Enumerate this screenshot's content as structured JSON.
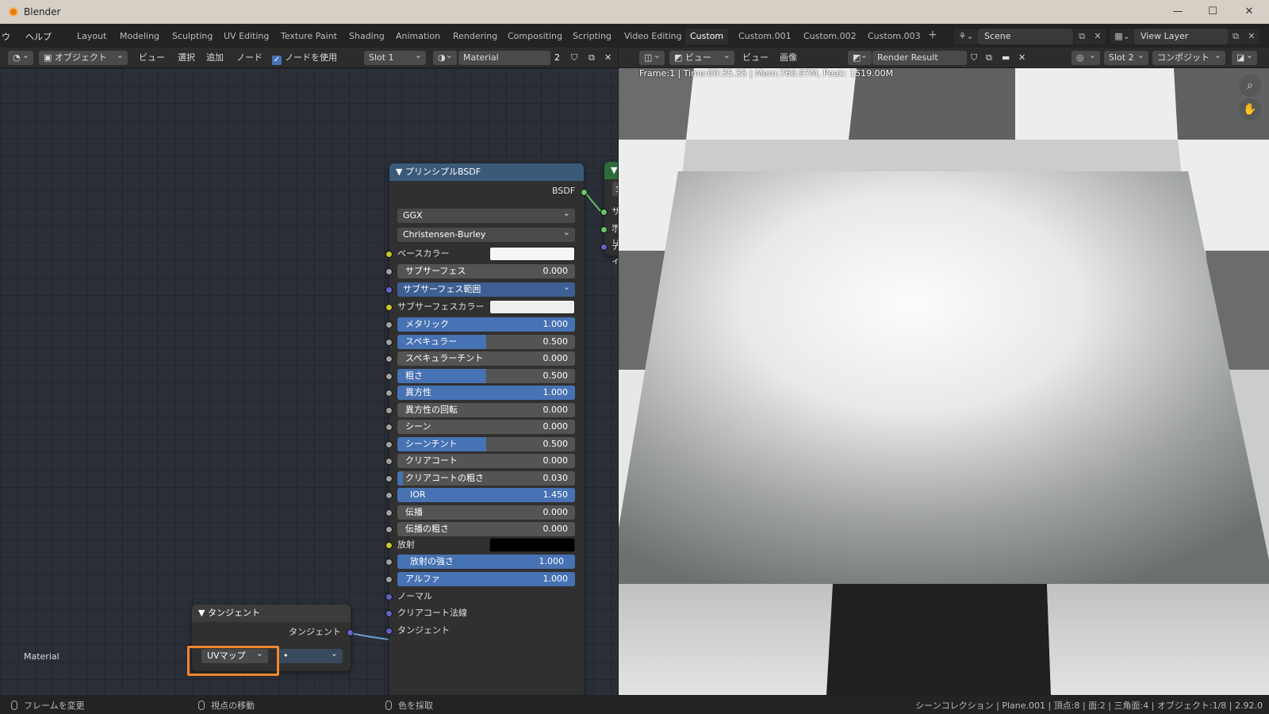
{
  "window": {
    "title": "Blender",
    "minimize": "—",
    "maximize": "☐",
    "close": "✕"
  },
  "menubar": {
    "partial": "ウ",
    "help": "ヘルプ"
  },
  "workspaces": [
    "Layout",
    "Modeling",
    "Sculpting",
    "UV Editing",
    "Texture Paint",
    "Shading",
    "Animation",
    "Rendering",
    "Compositing",
    "Scripting",
    "Video Editing",
    "Custom",
    "Custom.001",
    "Custom.002",
    "Custom.003"
  ],
  "active_workspace": "Custom",
  "add_workspace": "+",
  "scene": {
    "name": "Scene"
  },
  "view_layer": {
    "name": "View Layer"
  },
  "node_header": {
    "mode": "オブジェクト",
    "view": "ビュー",
    "select": "選択",
    "add": "追加",
    "node": "ノード",
    "use_nodes": "ノードを使用",
    "use_nodes_checked": "✓",
    "slot": "Slot 1",
    "material": "Material",
    "users": "2"
  },
  "image_header": {
    "view": "ビュー",
    "view2": "ビュー",
    "image": "画像",
    "render_result": "Render Result",
    "slot": "Slot 2",
    "pass": "コンポジット"
  },
  "render_info": "Frame:1 | Time:00:35.35 | Mem:760.97M, Peak: 1519.00M",
  "editor_label": "Material",
  "bsdf_node": {
    "title": "▼ プリンシプルBSDF",
    "output": "BSDF",
    "distribution": "GGX",
    "subsurface_method": "Christensen-Burley",
    "base_color_label": "ベースカラー",
    "base_color": "#f5f5f5",
    "subsurface": {
      "label": "サブサーフェス",
      "value": "0.000"
    },
    "subsurface_radius": "サブサーフェス範囲",
    "subsurface_color_label": "サブサーフェスカラー",
    "subsurface_color": "#eeeeee",
    "fields": [
      {
        "label": "メタリック",
        "value": "1.000",
        "fill": 1.0
      },
      {
        "label": "スペキュラー",
        "value": "0.500",
        "fill": 0.5
      },
      {
        "label": "スペキュラーチント",
        "value": "0.000",
        "fill": 0.0
      },
      {
        "label": "粗さ",
        "value": "0.500",
        "fill": 0.5
      },
      {
        "label": "異方性",
        "value": "1.000",
        "fill": 1.0
      },
      {
        "label": "異方性の回転",
        "value": "0.000",
        "fill": 0.0
      },
      {
        "label": "シーン",
        "value": "0.000",
        "fill": 0.0
      },
      {
        "label": "シーンチント",
        "value": "0.500",
        "fill": 0.5
      },
      {
        "label": "クリアコート",
        "value": "0.000",
        "fill": 0.0
      },
      {
        "label": "クリアコートの粗さ",
        "value": "0.030",
        "fill": 0.03
      },
      {
        "label": "IOR",
        "value": "1.450",
        "fill": 1.0
      },
      {
        "label": "伝播",
        "value": "0.000",
        "fill": 0.0
      },
      {
        "label": "伝播の粗さ",
        "value": "0.000",
        "fill": 0.0
      }
    ],
    "emission_label": "放射",
    "emission_color": "#000000",
    "emission_strength": {
      "label": "放射の強さ",
      "value": "1.000",
      "fill": 1.0
    },
    "alpha": {
      "label": "アルファ",
      "value": "1.000",
      "fill": 1.0
    },
    "normal": "ノーマル",
    "clearcoat_normal": "クリアコート法線",
    "tangent": "タンジェント"
  },
  "output_node": {
    "title": "▼ マ",
    "target": "全",
    "surface": "サー",
    "volume": "ボリ",
    "displacement": "ディ"
  },
  "tangent_node": {
    "title": "▼ タンジェント",
    "output": "タンジェント",
    "direction": "UVマップ",
    "uv_field": "•"
  },
  "statusbar": {
    "left1": "フレームを変更",
    "left2": "視点の移動",
    "left3": "色を採取",
    "right": "シーンコレクション | Plane.001 | 頂点:8 | 面:2 | 三角面:4 | オブジェクト:1/8 | 2.92.0"
  },
  "colors": {
    "accent": "#4772b3",
    "highlight": "#f0862e",
    "bsdf_header": "#3a5a7a",
    "output_header": "#2d6b3a"
  }
}
